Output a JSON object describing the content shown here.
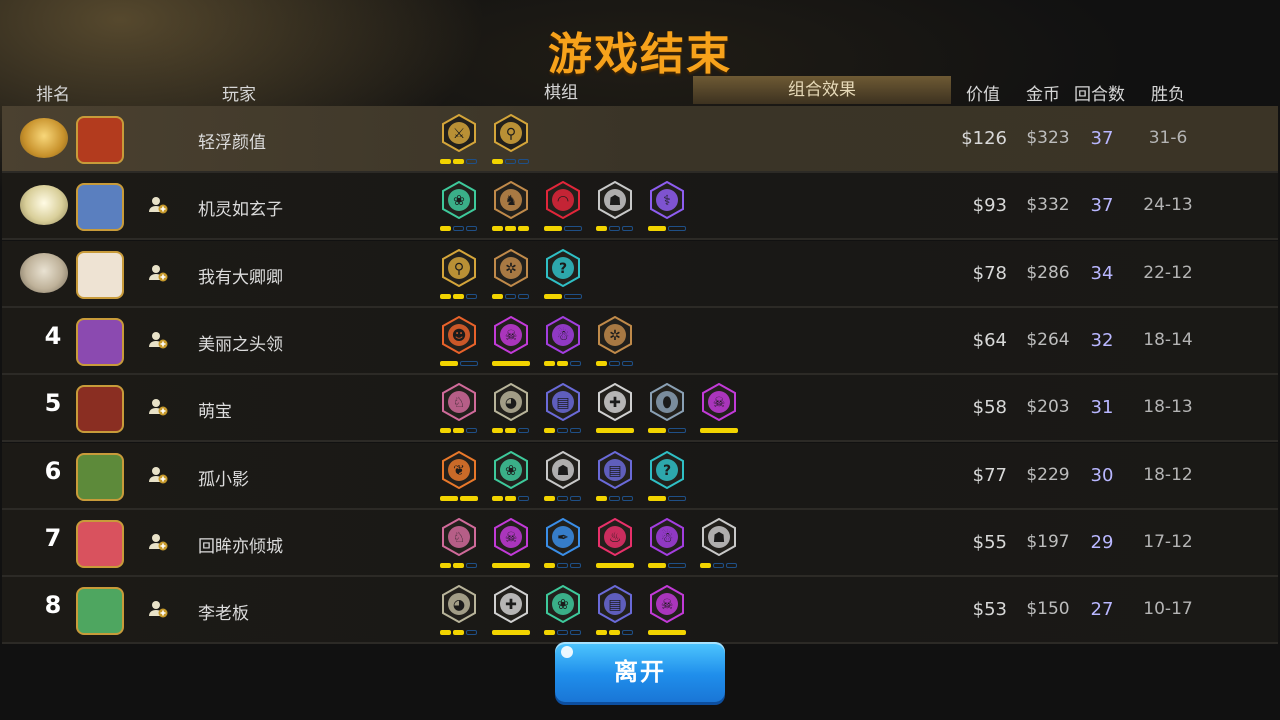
{
  "title": "游戏结束",
  "headers": {
    "rank": "排名",
    "player": "玩家",
    "lineup": "棋组",
    "effect": "组合效果",
    "value": "价值",
    "gold": "金币",
    "rounds": "回合数",
    "winloss": "胜负"
  },
  "colors": {
    "title": "#f7a21b",
    "rounds_text": "#b9b7ff",
    "bar_active": "#f2d400",
    "bar_inactive": "#1f4f86",
    "button": "#1f8eeb"
  },
  "players": [
    {
      "rank": "1",
      "medal": "gold",
      "name": "轻浮颜值",
      "value": "$126",
      "gold": "$323",
      "rounds": "37",
      "wl": "31-6",
      "friend": false,
      "synergies": [
        {
          "icon": "dual-blades-icon",
          "color": "#d4a53a",
          "on": 2,
          "segs": 3
        },
        {
          "icon": "keyhole-icon",
          "color": "#d4a53a",
          "on": 1,
          "segs": 3
        }
      ]
    },
    {
      "rank": "2",
      "medal": "silver",
      "name": "机灵如玄子",
      "value": "$93",
      "gold": "$332",
      "rounds": "37",
      "wl": "24-13",
      "friend": true,
      "synergies": [
        {
          "icon": "paw-icon",
          "color": "#3ec99b",
          "on": 1,
          "segs": 3
        },
        {
          "icon": "wolf-head-icon",
          "color": "#c08a4a",
          "on": 3,
          "segs": 3
        },
        {
          "icon": "dome-icon",
          "color": "#e1263a",
          "on": 1,
          "segs": 2
        },
        {
          "icon": "helmet-icon",
          "color": "#c8c8c8",
          "on": 1,
          "segs": 3
        },
        {
          "icon": "fishbone-icon",
          "color": "#8e5df0",
          "on": 1,
          "segs": 2
        }
      ]
    },
    {
      "rank": "3",
      "medal": "bronze",
      "name": "我有大卿卿",
      "value": "$78",
      "gold": "$286",
      "rounds": "34",
      "wl": "22-12",
      "friend": true,
      "synergies": [
        {
          "icon": "keyhole-icon",
          "color": "#d4a53a",
          "on": 2,
          "segs": 3
        },
        {
          "icon": "gear-icon",
          "color": "#c08a4a",
          "on": 1,
          "segs": 3
        },
        {
          "icon": "question-icon",
          "color": "#2fbfc5",
          "on": 1,
          "segs": 2
        }
      ]
    },
    {
      "rank": "4",
      "medal": "",
      "name": "美丽之头领",
      "value": "$64",
      "gold": "$264",
      "rounds": "32",
      "wl": "18-14",
      "friend": true,
      "synergies": [
        {
          "icon": "demon-face-icon",
          "color": "#e8622a",
          "on": 1,
          "segs": 2
        },
        {
          "icon": "skull-icon",
          "color": "#c23ad8",
          "on": 1,
          "segs": 1
        },
        {
          "icon": "ghost-icon",
          "color": "#a33ee0",
          "on": 2,
          "segs": 3
        },
        {
          "icon": "gear-icon",
          "color": "#c08a4a",
          "on": 1,
          "segs": 3
        }
      ]
    },
    {
      "rank": "5",
      "medal": "",
      "name": "萌宝",
      "value": "$58",
      "gold": "$203",
      "rounds": "31",
      "wl": "18-13",
      "friend": true,
      "synergies": [
        {
          "icon": "knight-icon",
          "color": "#d06a9a",
          "on": 2,
          "segs": 3
        },
        {
          "icon": "penguin-icon",
          "color": "#b8b49a",
          "on": 2,
          "segs": 3
        },
        {
          "icon": "tome-icon",
          "color": "#6a6ad8",
          "on": 1,
          "segs": 3
        },
        {
          "icon": "cross-icon",
          "color": "#d0d0d0",
          "on": 1,
          "segs": 1
        },
        {
          "icon": "egg-icon",
          "color": "#8aa0b4",
          "on": 1,
          "segs": 2
        },
        {
          "icon": "skull-icon",
          "color": "#c23ad8",
          "on": 1,
          "segs": 1
        }
      ]
    },
    {
      "rank": "6",
      "medal": "",
      "name": "孤小影",
      "value": "$77",
      "gold": "$229",
      "rounds": "30",
      "wl": "18-12",
      "friend": true,
      "synergies": [
        {
          "icon": "leaf-icon",
          "color": "#e8782a",
          "on": 2,
          "segs": 2
        },
        {
          "icon": "paw-icon",
          "color": "#3ec99b",
          "on": 2,
          "segs": 3
        },
        {
          "icon": "helmet-icon",
          "color": "#c8c8c8",
          "on": 1,
          "segs": 3
        },
        {
          "icon": "tome-icon",
          "color": "#6a6ad8",
          "on": 1,
          "segs": 3
        },
        {
          "icon": "question-icon",
          "color": "#2fbfc5",
          "on": 1,
          "segs": 2
        }
      ]
    },
    {
      "rank": "7",
      "medal": "",
      "name": "回眸亦倾城",
      "value": "$55",
      "gold": "$197",
      "rounds": "29",
      "wl": "17-12",
      "friend": true,
      "synergies": [
        {
          "icon": "knight-icon",
          "color": "#d06a9a",
          "on": 2,
          "segs": 3
        },
        {
          "icon": "skull-icon",
          "color": "#c23ad8",
          "on": 1,
          "segs": 1
        },
        {
          "icon": "feather-icon",
          "color": "#3a8ee8",
          "on": 1,
          "segs": 3
        },
        {
          "icon": "flame-icon",
          "color": "#e8306a",
          "on": 1,
          "segs": 1
        },
        {
          "icon": "ghost-icon",
          "color": "#a33ee0",
          "on": 1,
          "segs": 2
        },
        {
          "icon": "helmet-icon",
          "color": "#c8c8c8",
          "on": 1,
          "segs": 3
        }
      ]
    },
    {
      "rank": "8",
      "medal": "",
      "name": "李老板",
      "value": "$53",
      "gold": "$150",
      "rounds": "27",
      "wl": "10-17",
      "friend": true,
      "synergies": [
        {
          "icon": "penguin-icon",
          "color": "#b8b49a",
          "on": 2,
          "segs": 3
        },
        {
          "icon": "cross-icon",
          "color": "#d0d0d0",
          "on": 1,
          "segs": 1
        },
        {
          "icon": "paw-icon",
          "color": "#3ec99b",
          "on": 1,
          "segs": 3
        },
        {
          "icon": "tome-icon",
          "color": "#6a6ad8",
          "on": 2,
          "segs": 3
        },
        {
          "icon": "skull-icon",
          "color": "#c23ad8",
          "on": 1,
          "segs": 1
        }
      ]
    }
  ],
  "leave_button": "离开"
}
